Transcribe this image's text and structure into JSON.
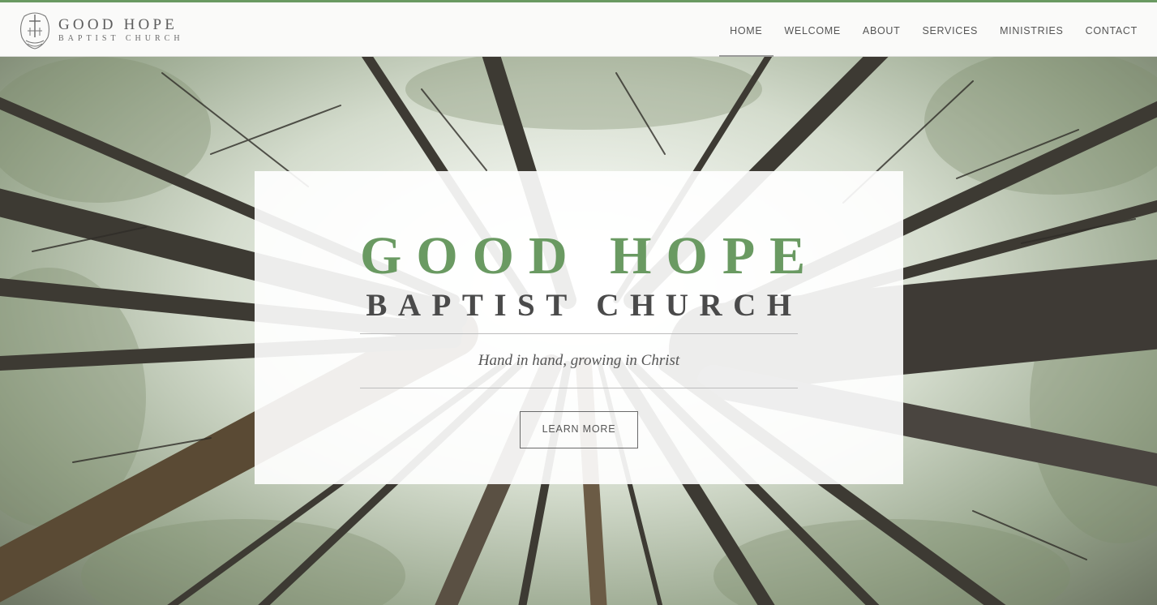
{
  "brand": {
    "title": "GOOD HOPE",
    "subtitle": "BAPTIST CHURCH",
    "logo_icon": "church-cross-logo-icon"
  },
  "nav": {
    "items": [
      {
        "label": "HOME",
        "active": true
      },
      {
        "label": "WELCOME",
        "active": false
      },
      {
        "label": "ABOUT",
        "active": false
      },
      {
        "label": "SERVICES",
        "active": false
      },
      {
        "label": "MINISTRIES",
        "active": false
      },
      {
        "label": "CONTACT",
        "active": false
      }
    ]
  },
  "hero": {
    "title": "GOOD HOPE",
    "subtitle": "BAPTIST CHURCH",
    "tagline": "Hand in hand, growing in Christ",
    "button_label": "LEARN MORE"
  },
  "colors": {
    "accent": "#6a9a62",
    "text": "#4a4a4a"
  }
}
